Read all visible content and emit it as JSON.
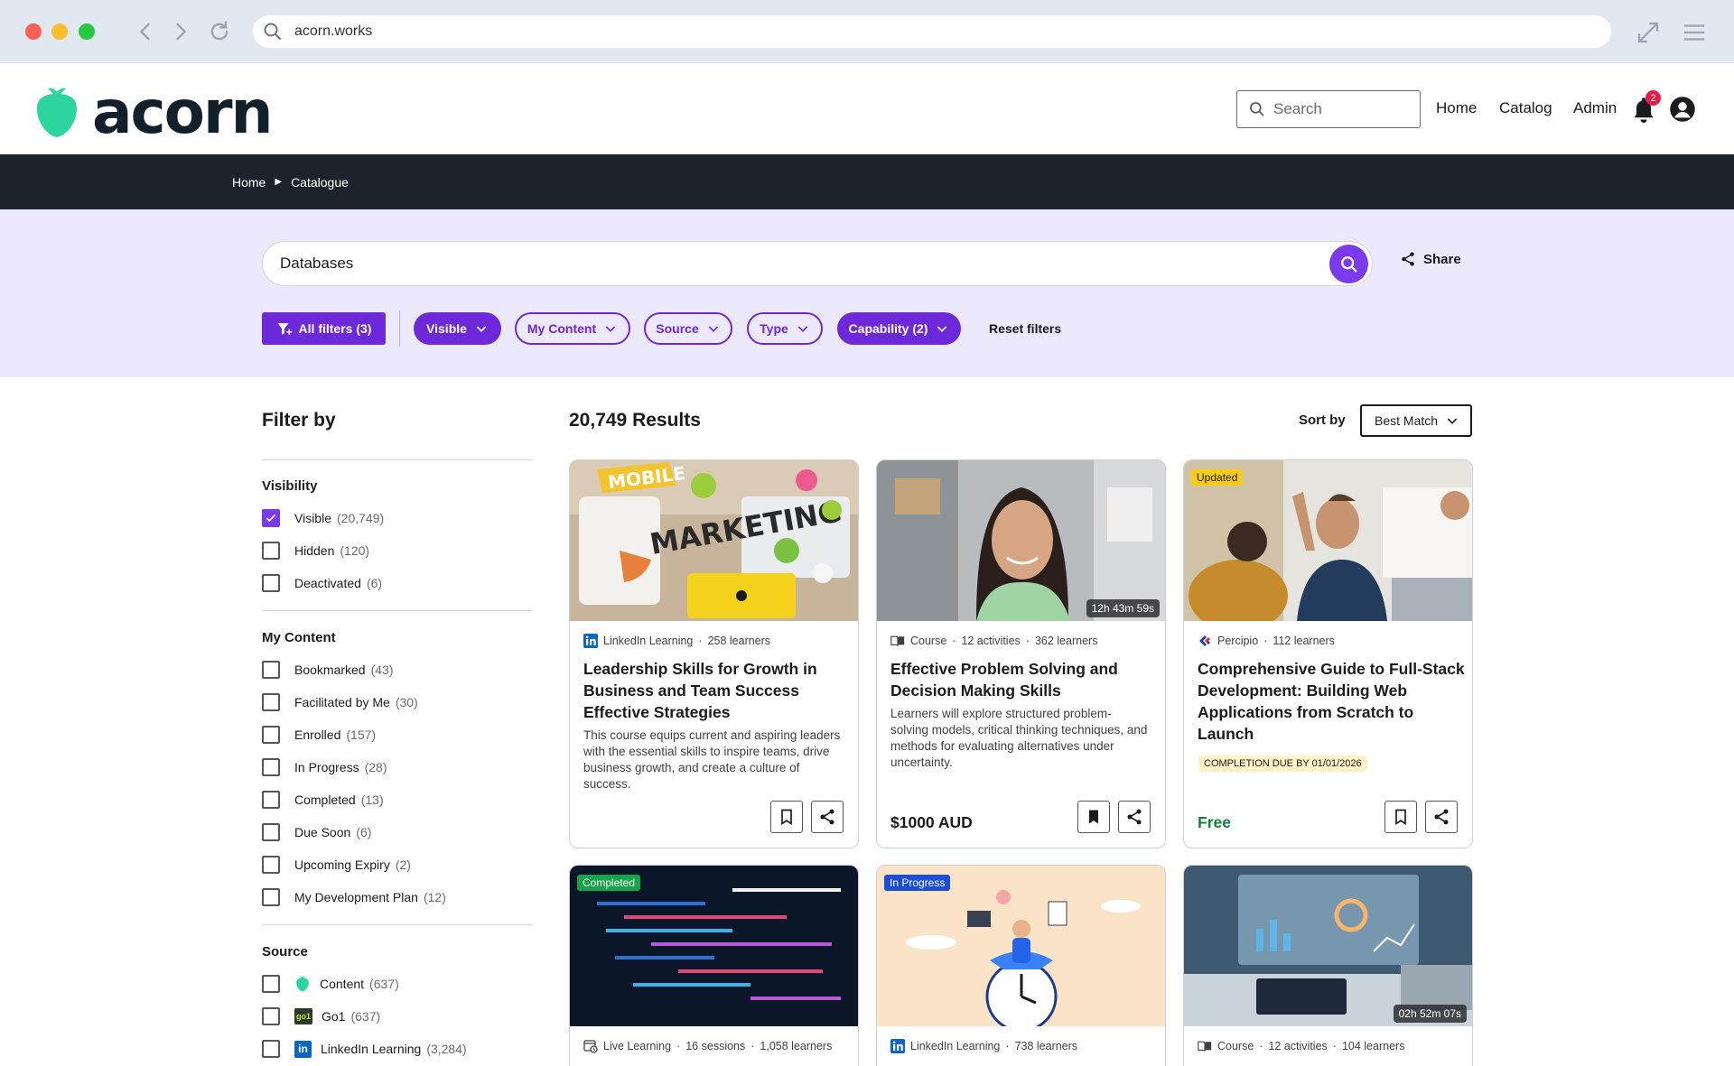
{
  "browser": {
    "url": "acorn.works"
  },
  "header": {
    "logo_text": "acorn",
    "search_placeholder": "Search",
    "nav": [
      "Home",
      "Catalog",
      "Admin"
    ],
    "notification_count": "2",
    "brand_color": "#2dd4a0"
  },
  "breadcrumb": [
    "Home",
    "Catalogue"
  ],
  "search": {
    "query": "Databases",
    "share_label": "Share"
  },
  "filters": {
    "all_filters_label": "All filters (3)",
    "chips": [
      {
        "label": "Visible",
        "active": true
      },
      {
        "label": "My Content",
        "active": false
      },
      {
        "label": "Source",
        "active": false
      },
      {
        "label": "Type",
        "active": false
      },
      {
        "label": "Capability (2)",
        "active": true
      }
    ],
    "reset_label": "Reset filters",
    "accent": "#6d28d9"
  },
  "sidebar": {
    "title": "Filter by",
    "groups": [
      {
        "title": "Visibility",
        "items": [
          {
            "label": "Visible",
            "count": "(20,749)",
            "checked": true
          },
          {
            "label": "Hidden",
            "count": "(120)",
            "checked": false
          },
          {
            "label": "Deactivated",
            "count": "(6)",
            "checked": false
          }
        ]
      },
      {
        "title": "My Content",
        "items": [
          {
            "label": "Bookmarked",
            "count": "(43)",
            "checked": false
          },
          {
            "label": "Facilitated by Me",
            "count": "(30)",
            "checked": false
          },
          {
            "label": "Enrolled",
            "count": "(157)",
            "checked": false
          },
          {
            "label": "In Progress",
            "count": "(28)",
            "checked": false
          },
          {
            "label": "Completed",
            "count": "(13)",
            "checked": false
          },
          {
            "label": "Due Soon",
            "count": "(6)",
            "checked": false
          },
          {
            "label": "Upcoming Expiry",
            "count": "(2)",
            "checked": false
          },
          {
            "label": "My Development Plan",
            "count": "(12)",
            "checked": false
          }
        ]
      },
      {
        "title": "Source",
        "items": [
          {
            "label": "Content",
            "count": "(637)",
            "checked": false,
            "icon": "acorn-leaf-icon"
          },
          {
            "label": "Go1",
            "count": "(637)",
            "checked": false,
            "icon": "go1-logo-icon",
            "icon_text": "go1"
          },
          {
            "label": "LinkedIn Learning",
            "count": "(3,284)",
            "checked": false,
            "icon": "linkedin-icon",
            "icon_text": "in"
          }
        ]
      }
    ]
  },
  "results": {
    "count_label": "20,749 Results",
    "sort_label": "Sort by",
    "sort_value": "Best Match"
  },
  "cards": [
    {
      "provider": "LinkedIn Learning",
      "provider_icon": "linkedin-icon",
      "meta": [
        "258 learners"
      ],
      "title": "Leadership Skills for Growth in Business and Team Success Effective Strategies",
      "description": "This course equips current and aspiring leaders with the essential skills to inspire teams, drive business growth, and create a culture of success.",
      "bookmarked": false,
      "image": "mobile-marketing-collage",
      "image_text": [
        "MOBILE",
        "MARKETING"
      ]
    },
    {
      "provider": "Course",
      "provider_icon": "book-icon",
      "meta": [
        "12 activities",
        "362 learners"
      ],
      "title": "Effective Problem Solving and Decision Making Skills",
      "description": "Learners will explore structured problem-solving models, critical thinking techniques, and methods for evaluating alternatives under uncertainty.",
      "duration": "12h 43m 59s",
      "price": "$1000 AUD",
      "bookmarked": true,
      "image": "smiling-woman-portrait"
    },
    {
      "provider": "Percipio",
      "provider_icon": "percipio-icon",
      "meta": [
        "112 learners"
      ],
      "title": "Comprehensive Guide to Full-Stack Development: Building Web Applications from Scratch to Launch",
      "tag": "Updated",
      "due": "COMPLETION DUE BY 01/01/2026",
      "price": "Free",
      "bookmarked": false,
      "image": "office-high-five"
    },
    {
      "provider": "Live Learning",
      "provider_icon": "calendar-clock-icon",
      "meta": [
        "16 sessions",
        "1,058 learners"
      ],
      "tag": "Completed",
      "image": "code-screen"
    },
    {
      "provider": "LinkedIn Learning",
      "provider_icon": "linkedin-icon",
      "meta": [
        "738 learners"
      ],
      "tag": "In Progress",
      "image": "time-management-illustration"
    },
    {
      "provider": "Course",
      "provider_icon": "book-icon",
      "meta": [
        "12 activities",
        "104 learners"
      ],
      "duration": "02h 52m 07s",
      "image": "analytics-dashboard-laptop"
    }
  ]
}
